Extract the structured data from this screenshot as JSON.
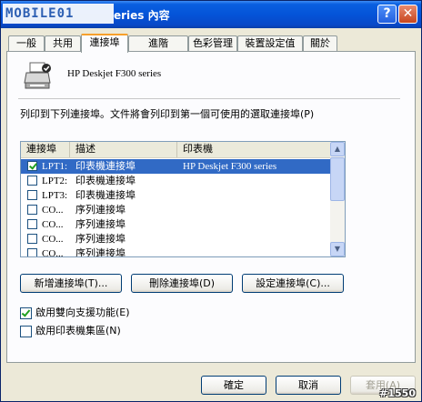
{
  "window": {
    "logo_text": "MOBILE01",
    "title": "eries 內容"
  },
  "tabs": [
    "一般",
    "共用",
    "連接埠",
    "進階",
    "色彩管理",
    "裝置設定值",
    "關於"
  ],
  "active_tab": 2,
  "printer": {
    "name": "HP Deskjet F300 series"
  },
  "description": "列印到下列連接埠。文件將會列印到第一個可使用的選取連接埠(P)",
  "ports": {
    "headers": [
      "連接埠",
      "描述",
      "印表機"
    ],
    "rows": [
      {
        "port": "LPT1:",
        "desc": "印表機連接埠",
        "printer": "HP Deskjet F300 series",
        "checked": true,
        "selected": true
      },
      {
        "port": "LPT2:",
        "desc": "印表機連接埠",
        "printer": "",
        "checked": false,
        "selected": false
      },
      {
        "port": "LPT3:",
        "desc": "印表機連接埠",
        "printer": "",
        "checked": false,
        "selected": false
      },
      {
        "port": "CO...",
        "desc": "序列連接埠",
        "printer": "",
        "checked": false,
        "selected": false
      },
      {
        "port": "CO...",
        "desc": "序列連接埠",
        "printer": "",
        "checked": false,
        "selected": false
      },
      {
        "port": "CO...",
        "desc": "序列連接埠",
        "printer": "",
        "checked": false,
        "selected": false
      },
      {
        "port": "CO...",
        "desc": "序列連接埠",
        "printer": "",
        "checked": false,
        "selected": false
      }
    ]
  },
  "port_buttons": {
    "add": "新增連接埠(T)...",
    "delete": "刪除連接埠(D)",
    "configure": "設定連接埠(C)..."
  },
  "options": {
    "bidirectional": {
      "label": "啟用雙向支援功能(E)",
      "checked": true
    },
    "pooling": {
      "label": "啟用印表機集區(N)",
      "checked": false
    }
  },
  "dialog_buttons": {
    "ok": "確定",
    "cancel": "取消",
    "apply": "套用(A)"
  },
  "watermark": "#1550"
}
